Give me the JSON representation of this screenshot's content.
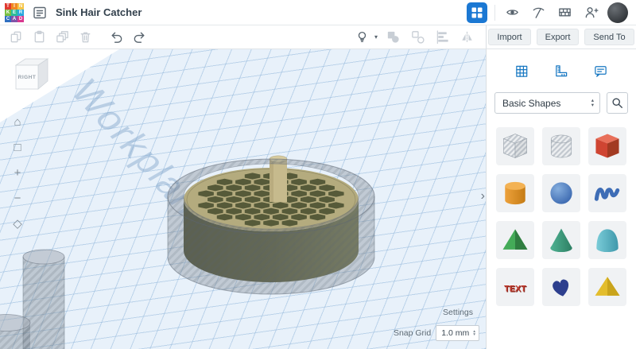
{
  "colors": {
    "accent_blue": "#1b78d3",
    "icon_gray": "#57636d",
    "icon_disabled": "#c8ced5",
    "sidebar_icon_blue": "#1878c2",
    "grid_bg": "#e8f1fa",
    "grid_line": "#96badc",
    "model_top": "#b4ab7e",
    "model_side": "#5b5e3d",
    "model_peg": "#c6ba8d",
    "hole_shell_gray": "rgba(116,126,138,0.34)"
  },
  "icons": {
    "caret_up": "▴",
    "caret_down": "▾",
    "chevron_right": "›"
  },
  "header": {
    "logo_letters": [
      {
        "ch": "T",
        "color": "#e0392f"
      },
      {
        "ch": "I",
        "color": "#f08a24"
      },
      {
        "ch": "N",
        "color": "#f6c64a"
      },
      {
        "ch": "K",
        "color": "#79bf43"
      },
      {
        "ch": "E",
        "color": "#2dbd9b"
      },
      {
        "ch": "R",
        "color": "#28a8dd"
      },
      {
        "ch": "C",
        "color": "#2f6fc1"
      },
      {
        "ch": "A",
        "color": "#8253a8"
      },
      {
        "ch": "D",
        "color": "#d8388f"
      }
    ],
    "title": "Sink Hair Catcher",
    "right_icons": [
      {
        "name": "view-gallery-icon"
      },
      {
        "name": "minecraft-pickaxe-icon"
      },
      {
        "name": "bricks-icon"
      },
      {
        "name": "share-person-icon"
      }
    ]
  },
  "toolbar": {
    "left_icons": [
      {
        "name": "copy-icon",
        "disabled": true
      },
      {
        "name": "paste-icon",
        "disabled": true
      },
      {
        "name": "duplicate-icon",
        "disabled": true
      },
      {
        "name": "delete-icon",
        "disabled": true
      },
      {
        "name": "undo-icon",
        "disabled": false
      },
      {
        "name": "redo-icon",
        "disabled": false
      }
    ],
    "right_icons": [
      {
        "name": "show-all-icon",
        "disabled": false,
        "caret": true
      },
      {
        "name": "group-icon",
        "disabled": true
      },
      {
        "name": "ungroup-icon",
        "disabled": true
      },
      {
        "name": "align-icon",
        "disabled": true
      },
      {
        "name": "mirror-icon",
        "disabled": true
      }
    ],
    "action_buttons": [
      {
        "label": "Import"
      },
      {
        "label": "Export"
      },
      {
        "label": "Send To"
      }
    ]
  },
  "sidebar": {
    "tools": [
      {
        "name": "workplane-tool-icon"
      },
      {
        "name": "ruler-tool-icon"
      },
      {
        "name": "notes-tool-icon"
      }
    ],
    "category_dropdown": {
      "value": "Basic Shapes"
    },
    "shapes": [
      {
        "id": "box-hole",
        "label": "Box (hole)",
        "style": "hatch"
      },
      {
        "id": "cylinder-hole",
        "label": "Cylinder (hole)",
        "style": "hatch"
      },
      {
        "id": "box",
        "label": "Box",
        "color": "#cf4532"
      },
      {
        "id": "cylinder",
        "label": "Cylinder",
        "color": "#e6952f"
      },
      {
        "id": "sphere",
        "label": "Sphere",
        "color": "#3e6db6"
      },
      {
        "id": "scribble",
        "label": "Scribble",
        "color": "#3e6db6"
      },
      {
        "id": "pyramid",
        "label": "Pyramid",
        "color": "#41a257"
      },
      {
        "id": "cone",
        "label": "Cone",
        "color": "#3da183"
      },
      {
        "id": "paraboloid",
        "label": "Paraboloid",
        "color": "#55b5c8"
      },
      {
        "id": "text",
        "label": "TEXT",
        "color": "#c23b2e"
      },
      {
        "id": "heart",
        "label": "Heart",
        "color": "#2d3f8e"
      },
      {
        "id": "polygon",
        "label": "Polygon",
        "color": "#e3bd2c"
      }
    ]
  },
  "canvas": {
    "watermark": "Workplane",
    "viewcube": {
      "front": "RIGHT"
    },
    "nav": [
      {
        "name": "home-view-icon",
        "glyph": "⌂"
      },
      {
        "name": "fit-view-icon",
        "glyph": "□"
      },
      {
        "name": "zoom-in-icon",
        "glyph": "+"
      },
      {
        "name": "zoom-out-icon",
        "glyph": "−"
      },
      {
        "name": "perspective-toggle-icon",
        "glyph": "◇"
      }
    ],
    "settings_label": "Settings",
    "snap_label": "Snap Grid",
    "snap_value": "1.0 mm"
  }
}
